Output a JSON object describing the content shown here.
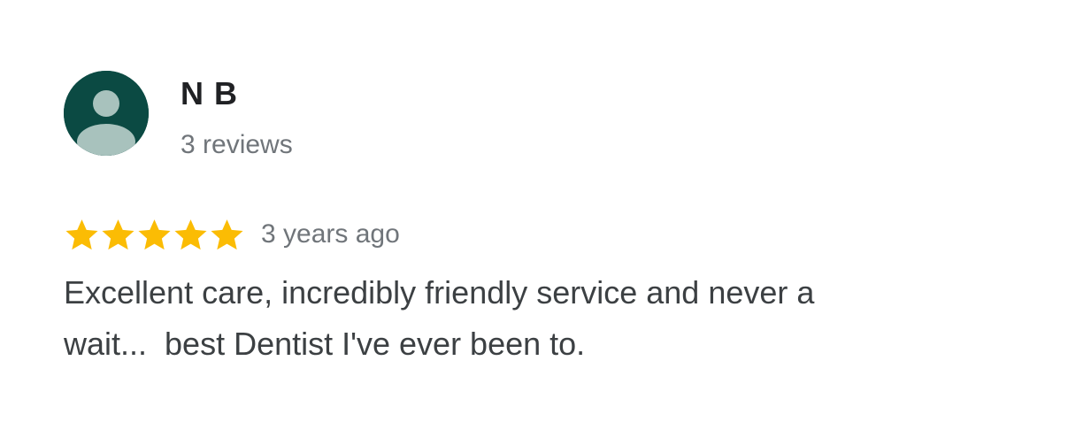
{
  "reviewer": {
    "name": "N B",
    "review_count": "3 reviews",
    "avatar_icon": "default-person-avatar-icon",
    "avatar_bg": "#0b4a43",
    "avatar_fg": "#a8c2bd"
  },
  "review": {
    "rating": 5,
    "max_rating": 5,
    "star_icon": "star-icon",
    "star_color": "#fbbc04",
    "date": "3 years ago",
    "text_lines": [
      "Excellent care, incredibly friendly service and never a",
      "wait...  best Dentist I've ever been to."
    ]
  }
}
